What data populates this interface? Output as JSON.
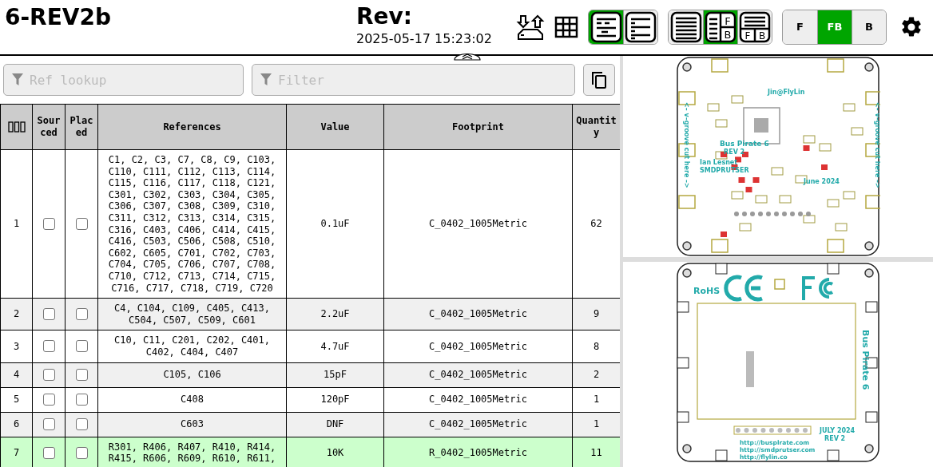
{
  "header": {
    "title": "6-REV2b",
    "rev_label": "Rev:",
    "date": "2025-05-17 15:23:02"
  },
  "toolbar": {
    "bom_modes": [
      {
        "kind": "grouped",
        "selected": true
      },
      {
        "kind": "ungrouped",
        "selected": false
      }
    ],
    "layouts": [
      {
        "kind": "bom-only",
        "selected": false
      },
      {
        "kind": "left-right",
        "label_top": "F",
        "label_bottom": "B",
        "selected": true
      },
      {
        "kind": "top-bottom",
        "label_top": "F",
        "label_bottom": "B",
        "selected": false
      }
    ],
    "sides": [
      {
        "label": "F",
        "selected": false
      },
      {
        "label": "FB",
        "selected": true
      },
      {
        "label": "B",
        "selected": false
      }
    ]
  },
  "filters": {
    "ref_lookup": {
      "placeholder": "Ref lookup"
    },
    "filter": {
      "placeholder": "Filter"
    }
  },
  "table": {
    "columns": [
      "Sourced",
      "Placed",
      "References",
      "Value",
      "Footprint",
      "Quantity"
    ],
    "rows": [
      {
        "index": "1",
        "sourced": false,
        "placed": false,
        "selected": false,
        "references": "C1, C2, C3, C7, C8, C9, C103, C110, C111, C112, C113, C114, C115, C116, C117, C118, C121, C301, C302, C303, C304, C305, C306, C307, C308, C309, C310, C311, C312, C313, C314, C315, C316, C403, C406, C414, C415, C416, C503, C506, C508, C510, C602, C605, C701, C702, C703, C704, C705, C706, C707, C708, C710, C712, C713, C714, C715, C716, C717, C718, C719, C720",
        "value": "0.1uF",
        "footprint": "C_0402_1005Metric",
        "quantity": "62"
      },
      {
        "index": "2",
        "sourced": false,
        "placed": false,
        "selected": false,
        "references": "C4, C104, C109, C405, C413, C504, C507, C509, C601",
        "value": "2.2uF",
        "footprint": "C_0402_1005Metric",
        "quantity": "9"
      },
      {
        "index": "3",
        "sourced": false,
        "placed": false,
        "selected": false,
        "references": "C10, C11, C201, C202, C401, C402, C404, C407",
        "value": "4.7uF",
        "footprint": "C_0402_1005Metric",
        "quantity": "8"
      },
      {
        "index": "4",
        "sourced": false,
        "placed": false,
        "selected": false,
        "references": "C105, C106",
        "value": "15pF",
        "footprint": "C_0402_1005Metric",
        "quantity": "2"
      },
      {
        "index": "5",
        "sourced": false,
        "placed": false,
        "selected": false,
        "references": "C408",
        "value": "120pF",
        "footprint": "C_0402_1005Metric",
        "quantity": "1"
      },
      {
        "index": "6",
        "sourced": false,
        "placed": false,
        "selected": false,
        "references": "C603",
        "value": "DNF",
        "footprint": "C_0402_1005Metric",
        "quantity": "1"
      },
      {
        "index": "7",
        "sourced": false,
        "placed": false,
        "selected": true,
        "references": "R301, R406, R407, R410, R414, R415, R606, R609, R610, R611,",
        "value": "10K",
        "footprint": "R_0402_1005Metric",
        "quantity": "11"
      }
    ]
  },
  "boards": {
    "front": {
      "texts": [
        "Jin@FlyLin",
        "Bus Pirate 6",
        "REV 2",
        "Ian Lesnet",
        "SMDPRUTSER",
        "June 2024"
      ],
      "side_texts": [
        "<– v–groove cut here –>",
        "<– v–groove cut here –>"
      ]
    },
    "back": {
      "texts": [
        "RoHS",
        "JULY 2024",
        "REV 2",
        "http://busplrate.com",
        "http://smdprutser.com",
        "http://flylin.co"
      ],
      "side_text": "Bus Pirate 6"
    }
  }
}
